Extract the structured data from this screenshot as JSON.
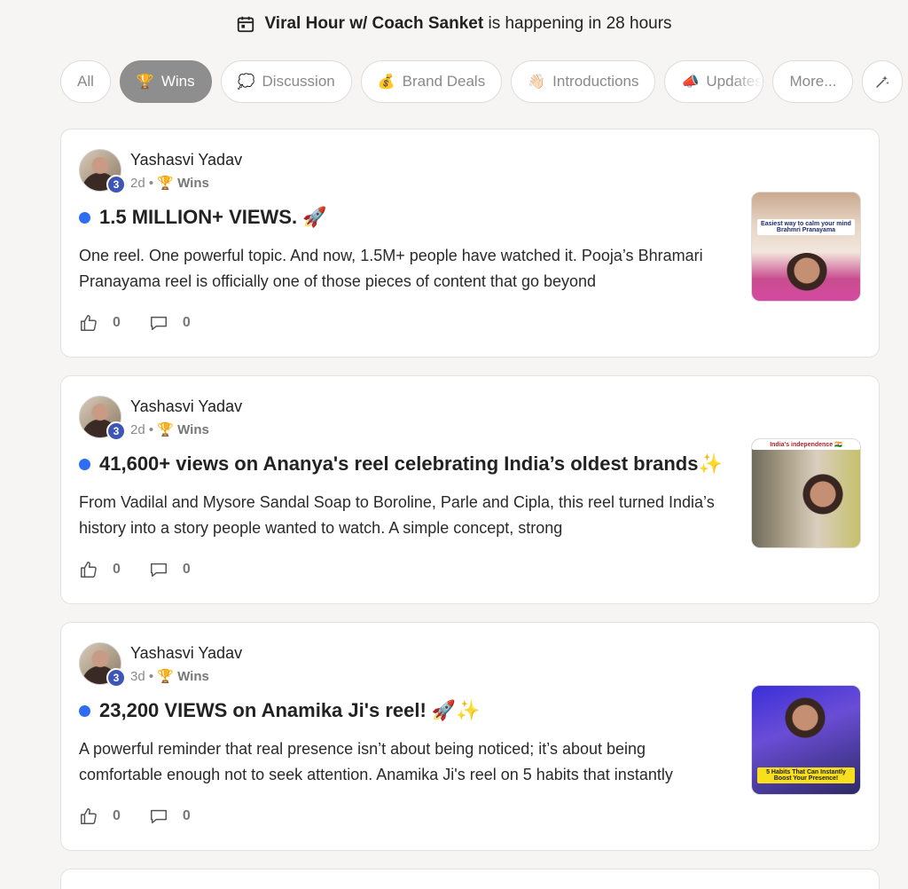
{
  "banner": {
    "event_name": "Viral Hour w/ Coach Sanket",
    "event_suffix": "is happening in 28 hours",
    "icon": "calendar-icon"
  },
  "filters": [
    {
      "label": "All",
      "emoji": "",
      "active": false
    },
    {
      "label": "Wins",
      "emoji": "🏆",
      "active": true
    },
    {
      "label": "Discussion",
      "emoji": "💭",
      "active": false
    },
    {
      "label": "Brand Deals",
      "emoji": "💰",
      "active": false
    },
    {
      "label": "Introductions",
      "emoji": "👋🏻",
      "active": false
    },
    {
      "label": "Updates",
      "emoji": "📣",
      "active": false
    },
    {
      "label": "More...",
      "emoji": "",
      "active": false
    }
  ],
  "posts": [
    {
      "author": "Yashasvi Yadav",
      "level": "3",
      "age": "2d",
      "category": "🏆 Wins",
      "title": "1.5 MILLION+ VIEWS. 🚀",
      "excerpt": "One reel. One powerful topic. And now, 1.5M+ people have watched it. Pooja’s Bhramari Pranayama reel is officially one of those pieces of content that go beyond",
      "likes": "0",
      "comments": "0",
      "thumb_caption": "Easiest way to calm your mind Brahmri Pranayama"
    },
    {
      "author": "Yashasvi Yadav",
      "level": "3",
      "age": "2d",
      "category": "🏆 Wins",
      "title": "41,600+ views on Ananya's reel celebrating India’s oldest brands✨",
      "excerpt": "From Vadilal and Mysore Sandal Soap to Boroline, Parle and Cipla, this reel turned India’s history into a story people wanted to watch. A simple concept, strong",
      "likes": "0",
      "comments": "0",
      "thumb_caption": "India's independence 🇮🇳"
    },
    {
      "author": "Yashasvi Yadav",
      "level": "3",
      "age": "3d",
      "category": "🏆 Wins",
      "title": "23,200 VIEWS on Anamika Ji's reel! 🚀✨",
      "excerpt": "A powerful reminder that real presence isn’t about being noticed; it’s about being comfortable enough not to seek attention. Anamika Ji's reel on 5 habits that instantly",
      "likes": "0",
      "comments": "0",
      "thumb_caption": "5 Habits That Can Instantly Boost Your Presence!"
    }
  ],
  "colors": {
    "unread_dot": "#2f6df5",
    "level_badge": "#3d55b4",
    "active_pill": "#8e8e8e"
  }
}
